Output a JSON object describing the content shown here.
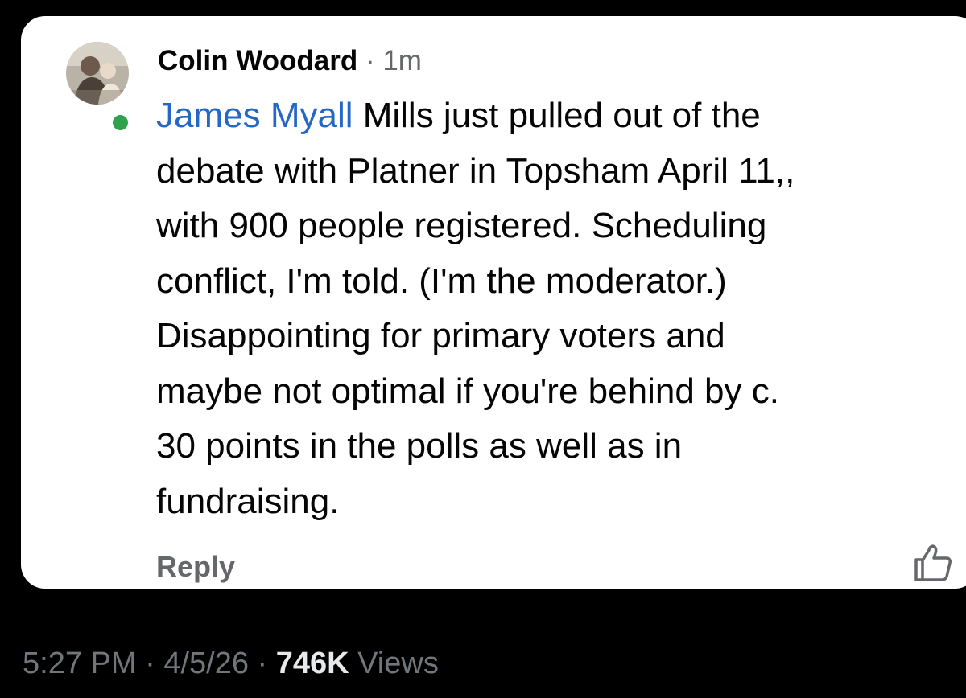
{
  "comment": {
    "author": "Colin Woodard",
    "separator": "·",
    "timestamp": "1m",
    "mention": "James Myall",
    "lines": [
      " Mills just pulled out of the",
      "debate with Platner in Topsham April 11,,",
      "with 900 people registered. Scheduling",
      "conflict, I'm told. (I'm the moderator.)",
      "Disappointing for primary voters and",
      "maybe not optimal if you're behind by c.",
      "30 points in the polls as well as in",
      "fundraising."
    ],
    "reply_label": "Reply",
    "avatar_icon": "profile-photo",
    "online_status_color": "#31a24c",
    "like_icon": "thumbs-up-icon",
    "mention_color": "#2467c6"
  },
  "tweet_meta": {
    "time": "5:27 PM",
    "sep1": " · ",
    "date": "4/5/26",
    "sep2": " · ",
    "views_count": "746K",
    "views_label": " Views"
  }
}
